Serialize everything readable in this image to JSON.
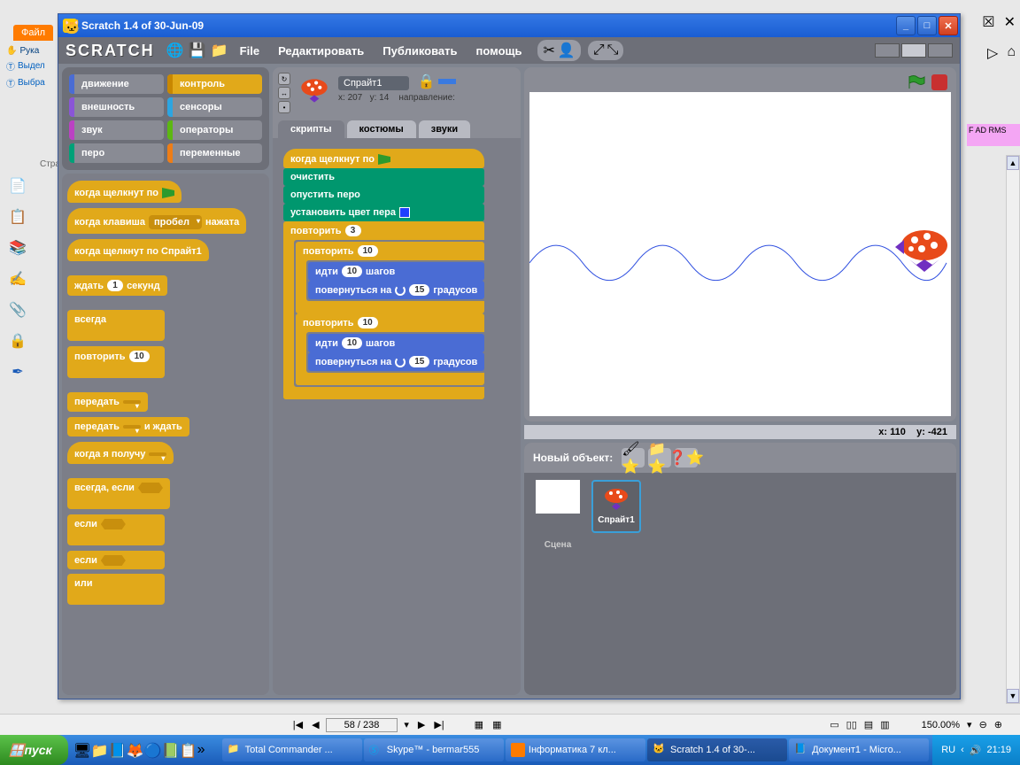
{
  "window": {
    "title": "Scratch 1.4 of 30-Jun-09"
  },
  "bg": {
    "file_tab": "Файл",
    "tools": [
      "Рука",
      "Выдел",
      "Выбра"
    ],
    "stra": "Стра",
    "right_tab": "F\nAD RMS"
  },
  "toolbar": {
    "logo": "SCRATCH",
    "menus": [
      "File",
      "Редактировать",
      "Публиковать",
      "помощь"
    ]
  },
  "categories": [
    {
      "key": "motion",
      "label": "движение"
    },
    {
      "key": "control",
      "label": "контроль"
    },
    {
      "key": "looks",
      "label": "внешность"
    },
    {
      "key": "sensing",
      "label": "сенсоры"
    },
    {
      "key": "sound",
      "label": "звук"
    },
    {
      "key": "operators",
      "label": "операторы"
    },
    {
      "key": "pen",
      "label": "перо"
    },
    {
      "key": "variables",
      "label": "переменные"
    }
  ],
  "palette": {
    "when_flag": "когда щелкнут по",
    "when_key": {
      "pre": "когда клавиша",
      "key": "пробел",
      "post": "нажата"
    },
    "when_sprite": "когда щелкнут по  Спрайт1",
    "wait": {
      "pre": "ждать",
      "val": "1",
      "post": "секунд"
    },
    "forever": "всегда",
    "repeat": {
      "label": "повторить",
      "val": "10"
    },
    "broadcast": "передать",
    "broadcast_wait": {
      "pre": "передать",
      "post": "и ждать"
    },
    "when_receive": "когда я получу",
    "forever_if": "всегда, если",
    "if": "если",
    "if_else": {
      "if": "если",
      "else": "или"
    }
  },
  "sprite": {
    "name": "Спрайт1",
    "x_label": "x:",
    "x": "207",
    "y_label": "y:",
    "y": "14",
    "dir_label": "направление:"
  },
  "tabs": [
    "скрипты",
    "костюмы",
    "звуки"
  ],
  "script": {
    "when_flag": "когда щелкнут по",
    "clear": "очистить",
    "pen_down": "опустить перо",
    "set_pen_color": "установить цвет пера",
    "repeat": "повторить",
    "repeat_outer_n": "3",
    "repeat_inner_n": "10",
    "move": {
      "pre": "идти",
      "n": "10",
      "post": "шагов"
    },
    "turn_ccw": {
      "pre": "повернуться на",
      "n": "15",
      "post": "градусов"
    },
    "turn_cw": {
      "pre": "повернуться на",
      "n": "15",
      "post": "градусов"
    }
  },
  "stage": {
    "coords": {
      "x_label": "x:",
      "x": "110",
      "y_label": "y:",
      "y": "-421"
    }
  },
  "sprite_panel": {
    "title": "Новый объект:",
    "stage_label": "Сцена",
    "sprite1": "Спрайт1"
  },
  "statusbar": {
    "page": "58 / 238",
    "zoom": "150.00%"
  },
  "taskbar": {
    "start": "пуск",
    "items": [
      "Total Commander ...",
      "Skype™ - bermar555",
      "Інформатика 7 кл...",
      "Scratch 1.4 of 30-...",
      "Документ1 - Micro..."
    ],
    "lang": "RU",
    "time": "21:19"
  }
}
